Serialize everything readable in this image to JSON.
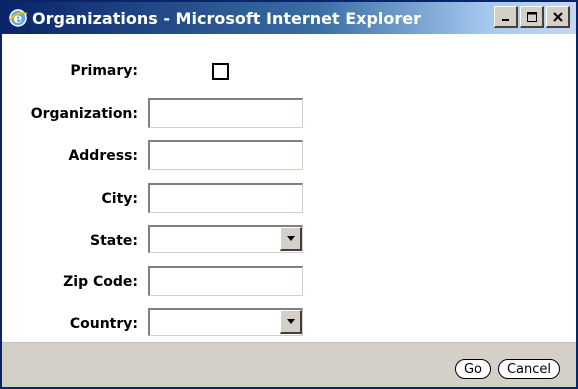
{
  "window": {
    "title": "Organizations - Microsoft Internet Explorer",
    "controls": [
      "minimize",
      "maximize",
      "close"
    ]
  },
  "form": {
    "primary_label": "Primary:",
    "primary_checked": false,
    "organization_label": "Organization:",
    "organization_value": "",
    "address_label": "Address:",
    "address_value": "",
    "city_label": "City:",
    "city_value": "",
    "state_label": "State:",
    "state_selected": "",
    "zip_label": "Zip Code:",
    "zip_value": "",
    "country_label": "Country:",
    "country_selected": ""
  },
  "footer": {
    "go_label": "Go",
    "cancel_label": "Cancel"
  }
}
